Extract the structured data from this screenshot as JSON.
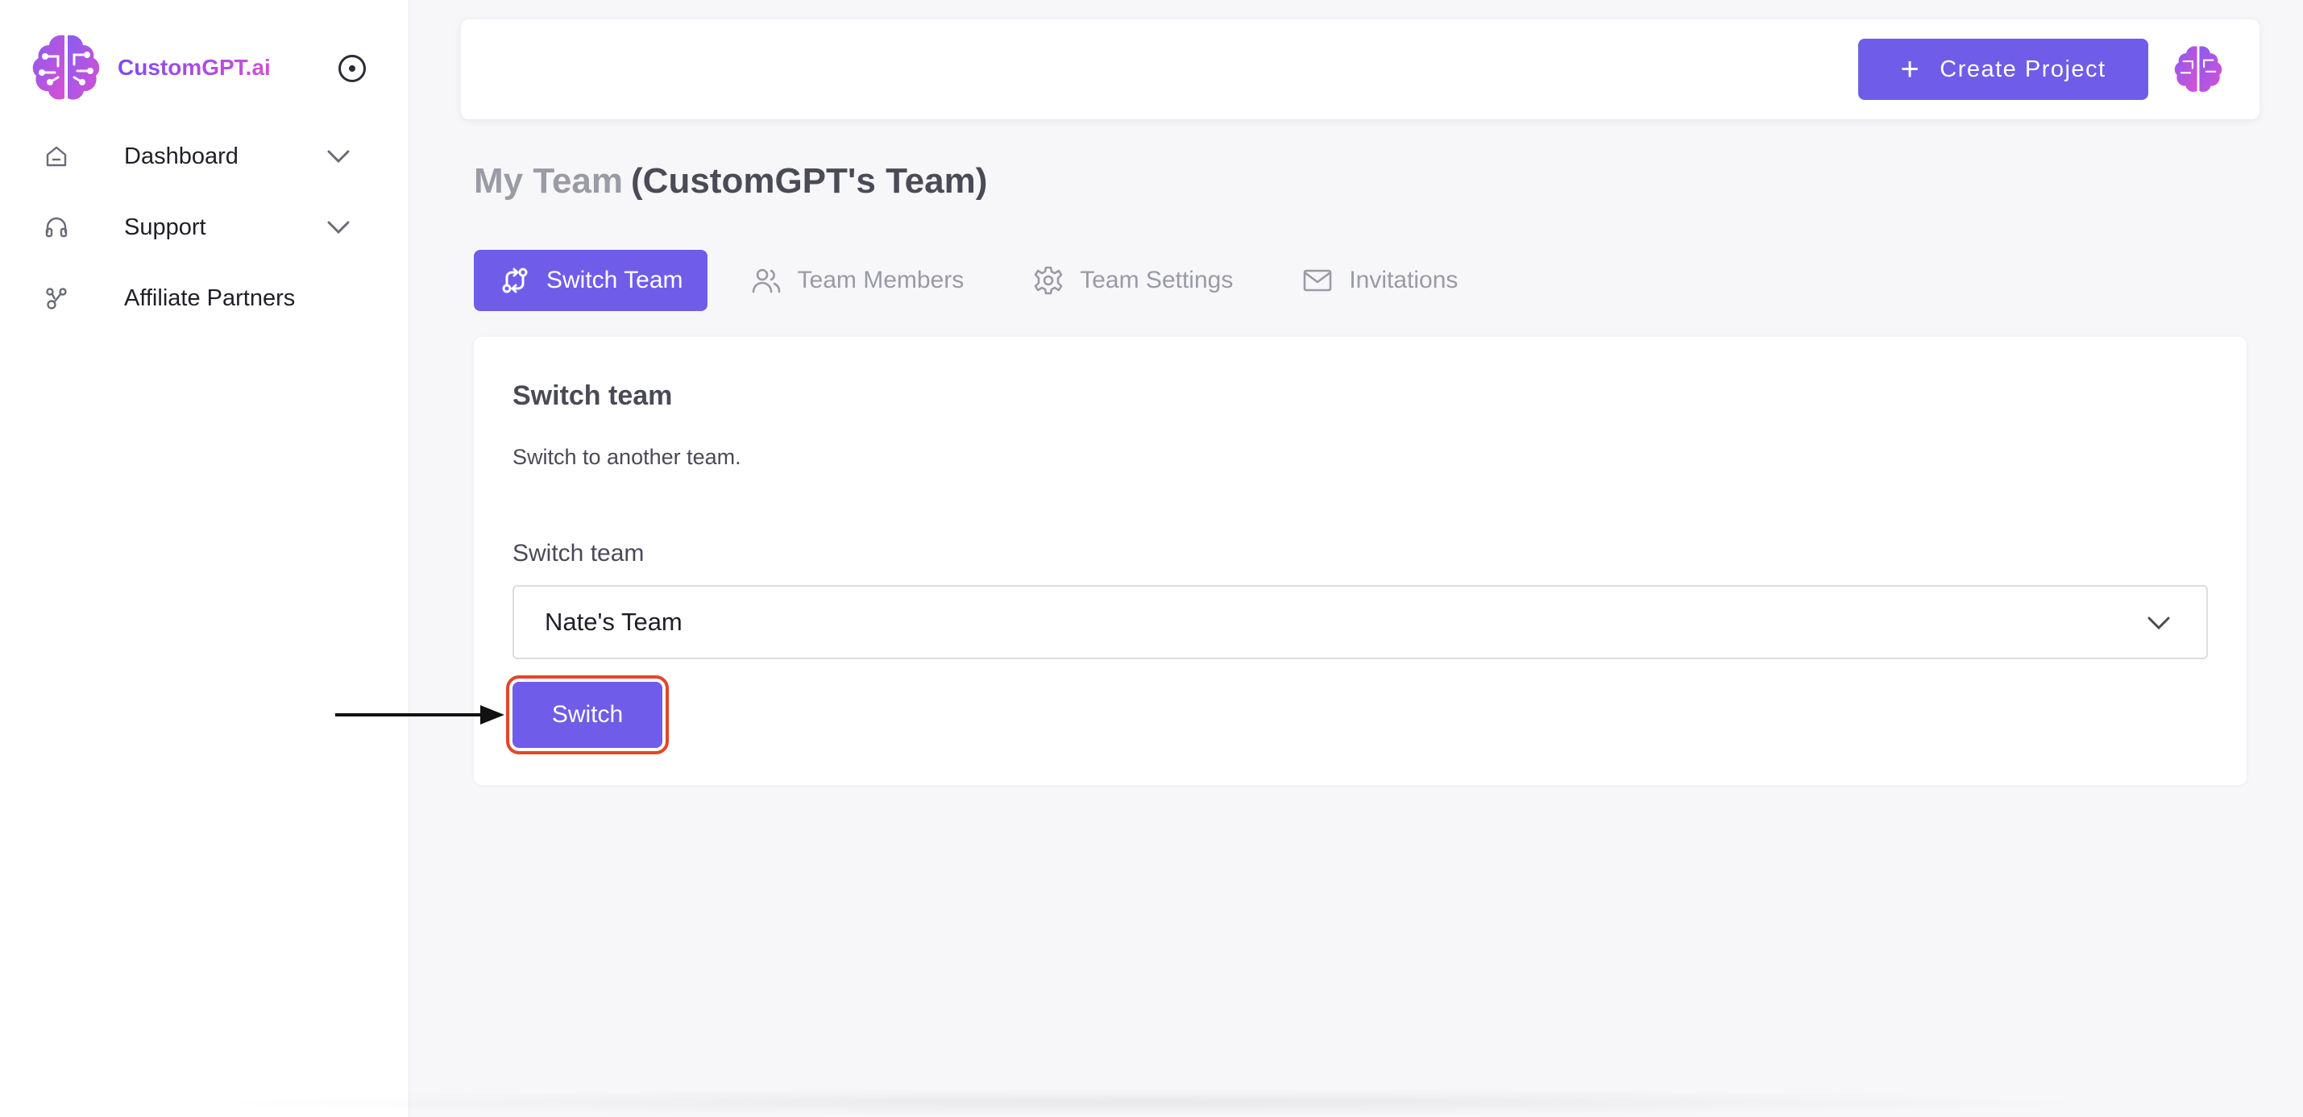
{
  "brand": {
    "name": "CustomGPT.ai"
  },
  "sidebar": {
    "items": [
      {
        "label": "Dashboard",
        "icon": "home-icon",
        "has_chevron": true
      },
      {
        "label": "Support",
        "icon": "headphones-icon",
        "has_chevron": true
      },
      {
        "label": "Affiliate Partners",
        "icon": "network-icon",
        "has_chevron": false
      }
    ]
  },
  "header": {
    "create_label": "Create Project"
  },
  "page": {
    "title_prefix": "My Team",
    "title_team": "(CustomGPT's Team)"
  },
  "tabs": [
    {
      "label": "Switch Team",
      "icon": "switch-icon",
      "active": true
    },
    {
      "label": "Team Members",
      "icon": "users-icon",
      "active": false
    },
    {
      "label": "Team Settings",
      "icon": "gear-icon",
      "active": false
    },
    {
      "label": "Invitations",
      "icon": "mail-icon",
      "active": false
    }
  ],
  "card": {
    "title": "Switch team",
    "description": "Switch to another team.",
    "field_label": "Switch team",
    "selected_team": "Nate's Team",
    "button_label": "Switch"
  },
  "colors": {
    "accent": "#6f5ce8",
    "highlight": "#e0472a"
  }
}
